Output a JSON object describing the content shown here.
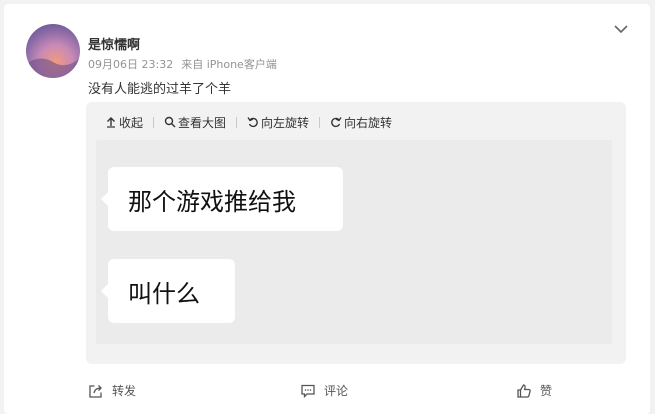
{
  "post": {
    "username": "是惊懦啊",
    "date": "09月06日 23:32",
    "source": "来自 iPhone客户端",
    "text": "没有人能逃的过羊了个羊"
  },
  "toolbar": {
    "collapse": "收起",
    "view_large": "查看大图",
    "rotate_left": "向左旋转",
    "rotate_right": "向右旋转"
  },
  "image": {
    "bubble1": "那个游戏推给我",
    "bubble2": "叫什么"
  },
  "actions": {
    "forward": "转发",
    "comment": "评论",
    "like": "赞"
  },
  "icons": [
    "chevron-down-icon",
    "collapse-icon",
    "search-icon",
    "rotate-left-icon",
    "rotate-right-icon",
    "forward-icon",
    "comment-icon",
    "like-icon"
  ]
}
